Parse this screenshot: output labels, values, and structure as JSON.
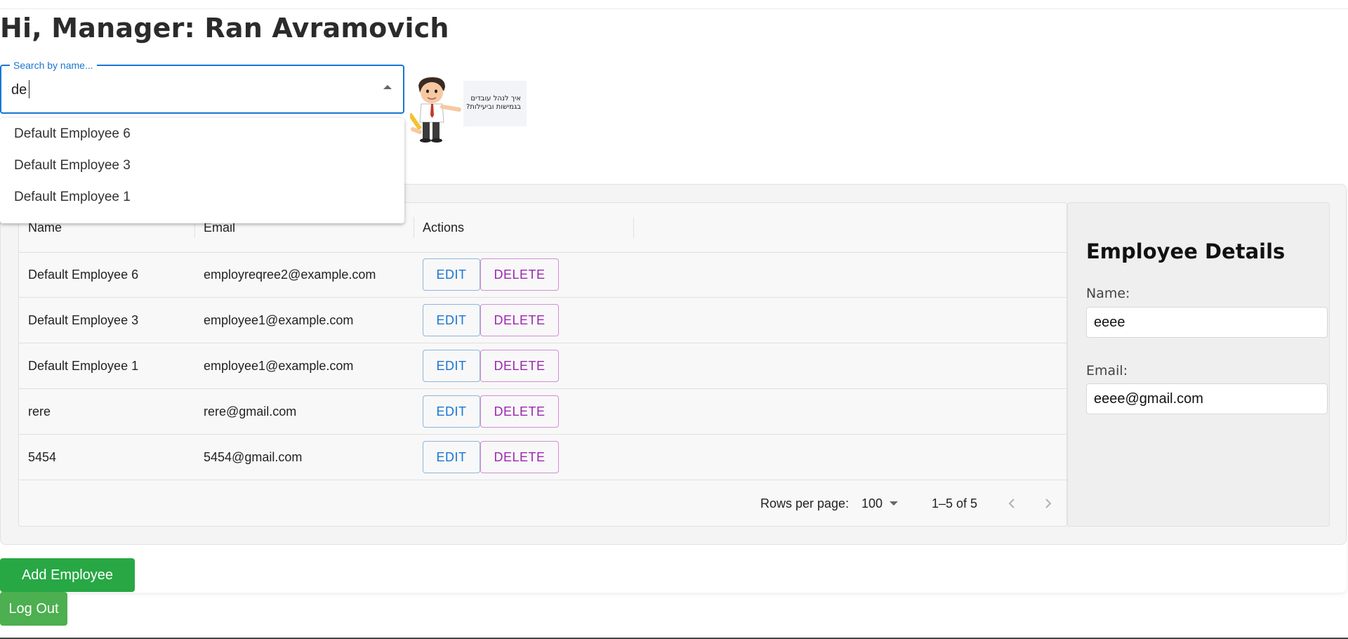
{
  "page": {
    "greeting": "Hi, Manager: Ran Avramovich"
  },
  "search": {
    "label": "Search by name...",
    "value": "de",
    "options": [
      "Default Employee 6",
      "Default Employee 3",
      "Default Employee 1"
    ]
  },
  "illustration": {
    "note_text": "איך לנהל עובדים בגמישות וביעילות?"
  },
  "table": {
    "columns": [
      "Name",
      "Email",
      "Actions"
    ],
    "edit_label": "EDIT",
    "delete_label": "DELETE",
    "rows": [
      {
        "name": "Default Employee 6",
        "email": "employreqree2@example.com"
      },
      {
        "name": "Default Employee 3",
        "email": "employee1@example.com"
      },
      {
        "name": "Default Employee 1",
        "email": "employee1@example.com"
      },
      {
        "name": "rere",
        "email": "rere@gmail.com"
      },
      {
        "name": "5454",
        "email": "5454@gmail.com"
      }
    ],
    "pagination": {
      "rows_per_page_label": "Rows per page:",
      "rows_per_page_value": "100",
      "range": "1–5 of 5"
    }
  },
  "details": {
    "title": "Employee Details",
    "name_label": "Name:",
    "name_value": "eeee",
    "email_label": "Email:",
    "email_value": "eeee@gmail.com"
  },
  "actions": {
    "add_label": "Add Employee",
    "logout_label": "Log Out"
  },
  "colors": {
    "primary": "#1976d2",
    "secondary": "#9c27b0",
    "add_button": "#28a745",
    "logout_button": "#4caf50"
  }
}
